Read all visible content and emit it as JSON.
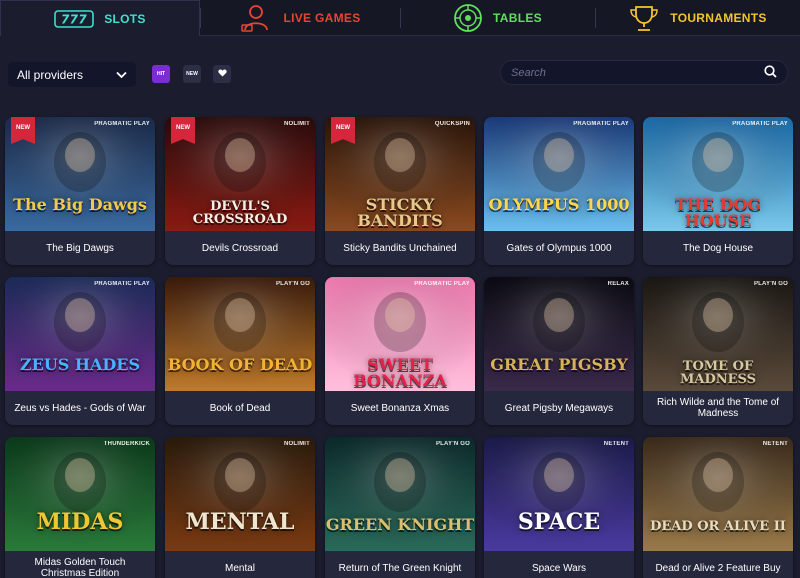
{
  "tabs": [
    {
      "label": "SLOTS",
      "icon": "slots-777-icon",
      "color": "#3ee0d0"
    },
    {
      "label": "LIVE GAMES",
      "icon": "live-dealer-icon",
      "color": "#e8452f"
    },
    {
      "label": "TABLES",
      "icon": "roulette-icon",
      "color": "#5fe05a"
    },
    {
      "label": "TOURNAMENTS",
      "icon": "trophy-icon",
      "color": "#f3c42b"
    }
  ],
  "filters": {
    "provider_select": "All providers",
    "chips": [
      "HIT",
      "NEW",
      "favorites-heart-icon"
    ],
    "search_placeholder": "Search"
  },
  "games": [
    {
      "title": "The Big Dawgs",
      "badge": "NEW",
      "provider": "PRAGMATIC PLAY",
      "logo": "The Big Dawgs",
      "bg": [
        "#1a2a4a",
        "#3a6aa0"
      ],
      "logo_color": "#f2c94c"
    },
    {
      "title": "Devils Crossroad",
      "badge": "NEW",
      "provider": "NOLIMIT",
      "logo": "DEVIL'S CROSSROAD",
      "bg": [
        "#2a0a0a",
        "#8a1a12"
      ],
      "logo_color": "#f3efe6"
    },
    {
      "title": "Sticky Bandits Unchained",
      "badge": "NEW",
      "provider": "QUICKSPIN",
      "logo": "STICKY BANDITS",
      "bg": [
        "#2a1408",
        "#8a4a20"
      ],
      "logo_color": "#e8c98a"
    },
    {
      "title": "Gates of Olympus 1000",
      "badge": "",
      "provider": "PRAGMATIC PLAY",
      "logo": "OLYMPUS 1000",
      "bg": [
        "#1a3a7a",
        "#6ac0f0"
      ],
      "logo_color": "#ffd54a"
    },
    {
      "title": "The Dog House",
      "badge": "",
      "provider": "PRAGMATIC PLAY",
      "logo": "THE DOG HOUSE",
      "bg": [
        "#1a6aa8",
        "#7ac8ea"
      ],
      "logo_color": "#e63b2e"
    },
    {
      "title": "Zeus vs Hades - Gods of War",
      "badge": "",
      "provider": "PRAGMATIC PLAY",
      "logo": "ZEUS HADES",
      "bg": [
        "#1a2a5a",
        "#6a2a8a"
      ],
      "logo_color": "#4ab0ff"
    },
    {
      "title": "Book of Dead",
      "badge": "",
      "provider": "PLAY'N GO",
      "logo": "BOOK OF DEAD",
      "bg": [
        "#3a1a0a",
        "#c07a2a"
      ],
      "logo_color": "#f2b233"
    },
    {
      "title": "Sweet Bonanza Xmas",
      "badge": "",
      "provider": "PRAGMATIC PLAY",
      "logo": "SWEET BONANZA",
      "bg": [
        "#f07ab0",
        "#ffc0dc"
      ],
      "logo_color": "#e8204a"
    },
    {
      "title": "Great Pigsby Megaways",
      "badge": "",
      "provider": "RELAX",
      "logo": "GREAT PIGSBY",
      "bg": [
        "#0a0a12",
        "#3a2a4a"
      ],
      "logo_color": "#d7b25a"
    },
    {
      "title": "Rich Wilde and the Tome of Madness",
      "badge": "",
      "provider": "PLAY'N GO",
      "logo": "TOME OF MADNESS",
      "bg": [
        "#1a1612",
        "#5a4a3a"
      ],
      "logo_color": "#d8c8a0"
    },
    {
      "title": "Midas Golden Touch Christmas Edition",
      "badge": "",
      "provider": "THUNDERKICK",
      "logo": "MIDAS",
      "bg": [
        "#0a3a1a",
        "#2a7a3a"
      ],
      "logo_color": "#f2c533"
    },
    {
      "title": "Mental",
      "badge": "",
      "provider": "NOLIMIT",
      "logo": "MENTAL",
      "bg": [
        "#2a1a0a",
        "#7a3a12"
      ],
      "logo_color": "#f0e6d0"
    },
    {
      "title": "Return of The Green Knight",
      "badge": "",
      "provider": "PLAY'N GO",
      "logo": "GREEN KNIGHT",
      "bg": [
        "#0a2a2a",
        "#2a6a5a"
      ],
      "logo_color": "#d8c070"
    },
    {
      "title": "Space Wars",
      "badge": "",
      "provider": "NETENT",
      "logo": "SPACE",
      "bg": [
        "#1a1a4a",
        "#4a3aa0"
      ],
      "logo_color": "#ffffff"
    },
    {
      "title": "Dead or Alive 2 Feature Buy",
      "badge": "",
      "provider": "NETENT",
      "logo": "DEAD OR ALIVE II",
      "bg": [
        "#3a2a1a",
        "#9a7a4a"
      ],
      "logo_color": "#e8dcc0"
    }
  ]
}
